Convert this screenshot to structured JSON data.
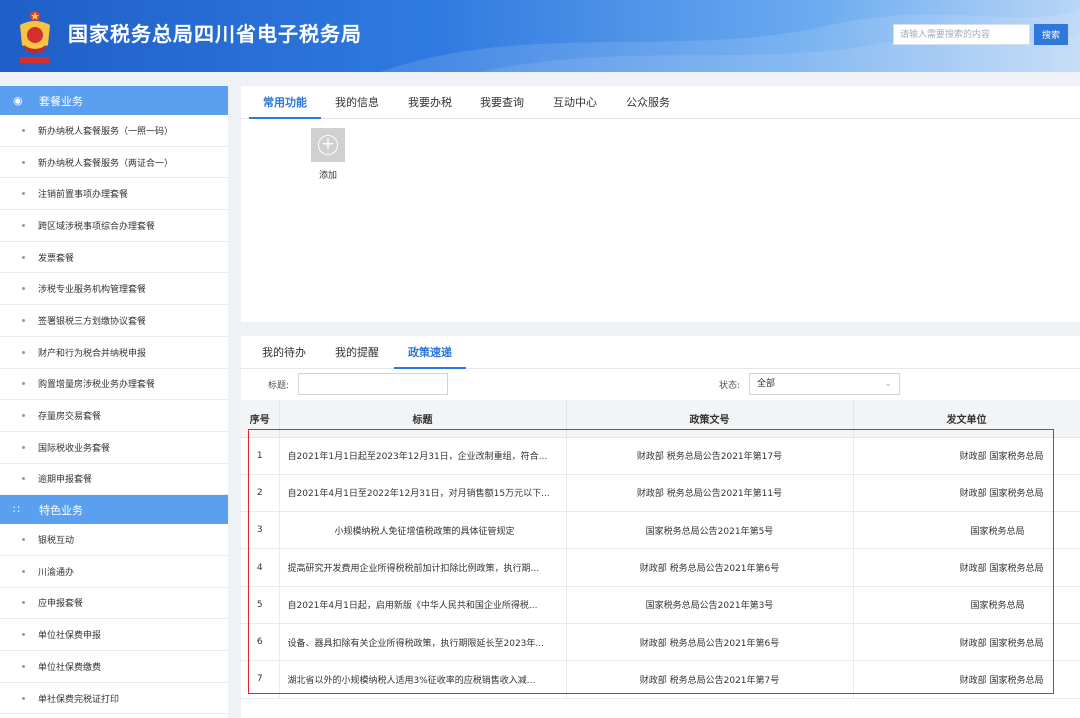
{
  "header": {
    "logo_text": "中国税务",
    "title": "国家税务总局四川省电子税务局",
    "search_placeholder": "请输入需要搜索的内容",
    "search_button": "搜索"
  },
  "sidebar": {
    "groups": [
      {
        "label": "套餐业务",
        "icon": "layers-icon",
        "items": [
          "新办纳税人套餐服务（一照一码）",
          "新办纳税人套餐服务（两证合一）",
          "注销前置事项办理套餐",
          "跨区域涉税事项综合办理套餐",
          "发票套餐",
          "涉税专业服务机构管理套餐",
          "签署银税三方划缴协议套餐",
          "财产和行为税合并纳税申报",
          "购置增量房涉税业务办理套餐",
          "存量房交易套餐",
          "国际税收业务套餐",
          "逾期申报套餐"
        ]
      },
      {
        "label": "特色业务",
        "icon": "grid-icon",
        "items": [
          "银税互动",
          "川渝通办",
          "应申报套餐",
          "单位社保费申报",
          "单位社保费缴费",
          "单社保费完税证打印"
        ]
      }
    ]
  },
  "functions": {
    "tabs": [
      "常用功能",
      "我的信息",
      "我要办税",
      "我要查询",
      "互动中心",
      "公众服务"
    ],
    "active_tab": 0,
    "add_label": "添加"
  },
  "policy": {
    "tabs": [
      "我的待办",
      "我的提醒",
      "政策速递"
    ],
    "active_tab": 2,
    "filter_title_label": "标题:",
    "filter_status_label": "状态:",
    "filter_status_value": "全部",
    "columns": [
      "序号",
      "标题",
      "政策文号",
      "发文单位"
    ],
    "rows": [
      {
        "idx": "1",
        "title": "自2021年1月1日起至2023年12月31日，企业改制重组，符合...",
        "doc": "财政部 税务总局公告2021年第17号",
        "org": "财政部 国家税务总局"
      },
      {
        "idx": "2",
        "title": "自2021年4月1日至2022年12月31日，对月销售额15万元以下...",
        "doc": "财政部 税务总局公告2021年第11号",
        "org": "财政部 国家税务总局"
      },
      {
        "idx": "3",
        "title": "小规模纳税人免征增值税政策的具体征管规定",
        "doc": "国家税务总局公告2021年第5号",
        "org": "国家税务总局"
      },
      {
        "idx": "4",
        "title": "提高研究开发费用企业所得税税前加计扣除比例政策，执行期...",
        "doc": "财政部 税务总局公告2021年第6号",
        "org": "财政部 国家税务总局"
      },
      {
        "idx": "5",
        "title": "自2021年4月1日起，启用新版《中华人民共和国企业所得税...",
        "doc": "国家税务总局公告2021年第3号",
        "org": "国家税务总局"
      },
      {
        "idx": "6",
        "title": "设备、器具扣除有关企业所得税政策，执行期限延长至2023年...",
        "doc": "财政部 税务总局公告2021年第6号",
        "org": "财政部 国家税务总局"
      },
      {
        "idx": "7",
        "title": "湖北省以外的小规模纳税人适用3%征收率的应税销售收入减...",
        "doc": "财政部 税务总局公告2021年第7号",
        "org": "财政部 国家税务总局"
      }
    ]
  },
  "colors": {
    "header_blue": "#2f7ae0",
    "sidebar_group": "#5aa0ee",
    "accent": "#2d78d8",
    "highlight_red": "#e0252b"
  }
}
